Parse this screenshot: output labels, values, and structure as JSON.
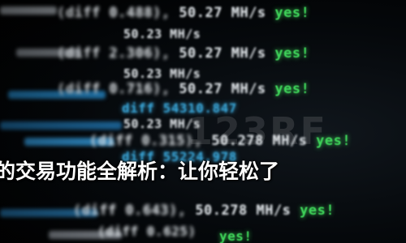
{
  "lines": [
    {
      "diff": "(diff 0.488),",
      "rate": "50.27 MH/s",
      "status": "yes!"
    },
    {
      "rate": "50.23 MH/s"
    },
    {
      "diff": "(diff 2.306),",
      "rate": "50.27 MH/s",
      "status": "yes!"
    },
    {
      "rate": "50.23 MH/s"
    },
    {
      "diff": "(diff 0.716),",
      "rate": "50.27 MH/s",
      "status": "yes!"
    },
    {
      "diff": "diff 54310.847"
    },
    {
      "rate": "50.23 MH/s"
    },
    {
      "diff": "(diff 0.315),",
      "rate": "50.278 MH/s",
      "status": "yes!"
    },
    {
      "diff": "diff 55224.978"
    },
    {
      "diff": "(diff 0.643),",
      "rate": "50.278 MH/s",
      "status": "yes!"
    },
    {
      "diff": "(diff 0.625)",
      "status": "yes!"
    }
  ],
  "watermark": "123RF",
  "caption": "的交易功能全解析：让你轻松了"
}
